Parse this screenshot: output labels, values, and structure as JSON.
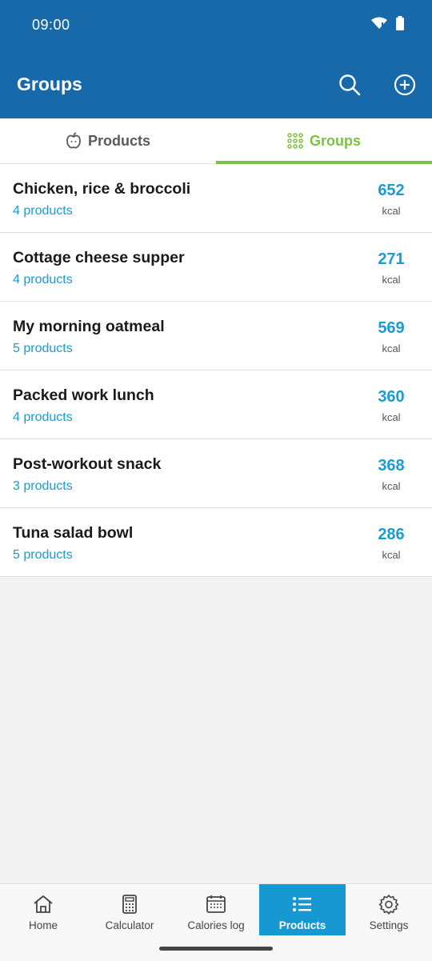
{
  "status": {
    "time": "09:00"
  },
  "appbar": {
    "title": "Groups"
  },
  "tabs": [
    {
      "label": "Products",
      "icon": "apple-icon",
      "active": false
    },
    {
      "label": "Groups",
      "icon": "grid-icon",
      "active": true
    }
  ],
  "groups": [
    {
      "name": "Chicken, rice & broccoli",
      "count": "4 products",
      "kcal": "652",
      "unit": "kcal"
    },
    {
      "name": "Cottage cheese supper",
      "count": "4 products",
      "kcal": "271",
      "unit": "kcal"
    },
    {
      "name": "My morning oatmeal",
      "count": "5 products",
      "kcal": "569",
      "unit": "kcal"
    },
    {
      "name": "Packed work lunch",
      "count": "4 products",
      "kcal": "360",
      "unit": "kcal"
    },
    {
      "name": "Post-workout snack",
      "count": "3 products",
      "kcal": "368",
      "unit": "kcal"
    },
    {
      "name": "Tuna salad bowl",
      "count": "5 products",
      "kcal": "286",
      "unit": "kcal"
    }
  ],
  "nav": [
    {
      "label": "Home",
      "icon": "home-icon"
    },
    {
      "label": "Calculator",
      "icon": "calculator-icon"
    },
    {
      "label": "Calories log",
      "icon": "calendar-icon"
    },
    {
      "label": "Products",
      "icon": "list-icon",
      "active": true
    },
    {
      "label": "Settings",
      "icon": "gear-icon"
    }
  ],
  "colors": {
    "appbar": "#1769aa",
    "accent_green": "#7cc142",
    "accent_blue": "#1a9bd1",
    "nav_active": "#1699d3"
  }
}
